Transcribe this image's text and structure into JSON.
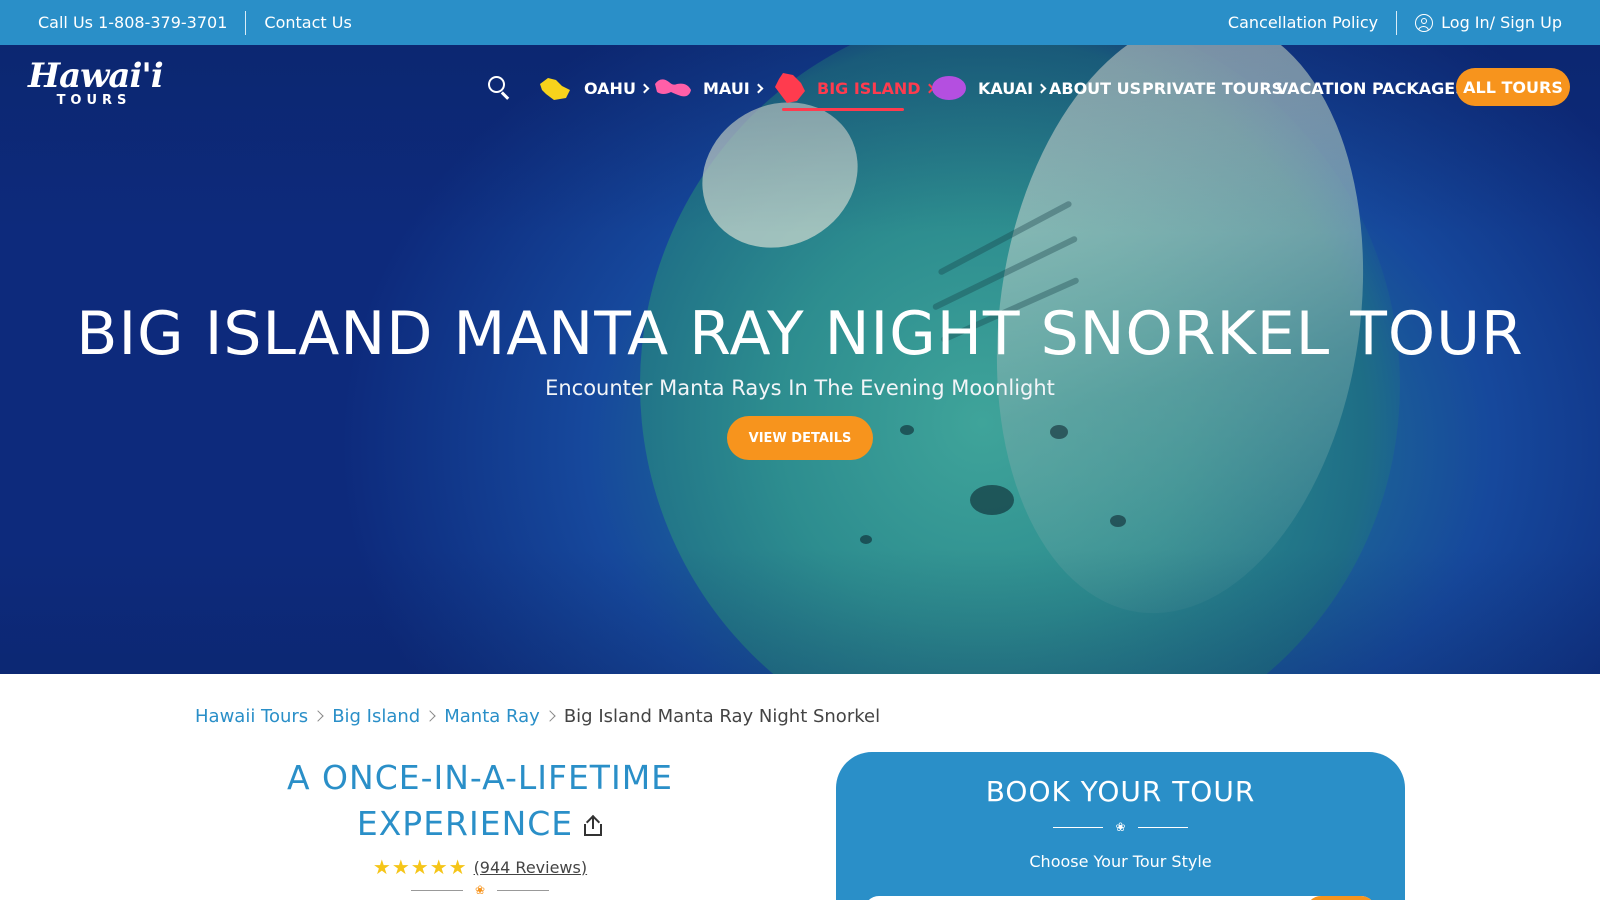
{
  "topbar": {
    "phone": "Call Us 1-808-379-3701",
    "contact": "Contact Us",
    "cancellation": "Cancellation Policy",
    "login": "Log In/ Sign Up"
  },
  "logo": {
    "main": "Hawai'i",
    "sub": "TOURS"
  },
  "nav": {
    "items": [
      {
        "label": "OAHU",
        "island_color": "#f7d31c"
      },
      {
        "label": "MAUI",
        "island_color": "#ff5fa8"
      },
      {
        "label": "BIG ISLAND",
        "island_color": "#ff3b4e"
      },
      {
        "label": "KAUAI",
        "island_color": "#b44fe0"
      },
      {
        "label": "ABOUT US"
      },
      {
        "label": "PRIVATE TOURS"
      },
      {
        "label": "VACATION PACKAGES"
      }
    ],
    "active": "BIG ISLAND",
    "cta": "ALL TOURS"
  },
  "hero": {
    "title": "BIG ISLAND MANTA RAY NIGHT SNORKEL TOUR",
    "subtitle": "Encounter Manta Rays In The Evening Moonlight",
    "button": "VIEW DETAILS"
  },
  "breadcrumb": {
    "items": [
      "Hawaii Tours",
      "Big Island",
      "Manta Ray"
    ],
    "current": "Big Island Manta Ray Night Snorkel"
  },
  "experience": {
    "title_line1": "A ONCE-IN-A-LIFETIME",
    "title_line2": "EXPERIENCE",
    "stars": "★★★★★",
    "reviews": "(944 Reviews)"
  },
  "booking": {
    "title": "BOOK YOUR TOUR",
    "choose_label": "Choose Your Tour Style"
  },
  "colors": {
    "topbar": "#2a8fc8",
    "accent_orange": "#f7941d",
    "active_red": "#ff3b4e",
    "link_blue": "#2a8fc8",
    "star_yellow": "#f5c518"
  }
}
